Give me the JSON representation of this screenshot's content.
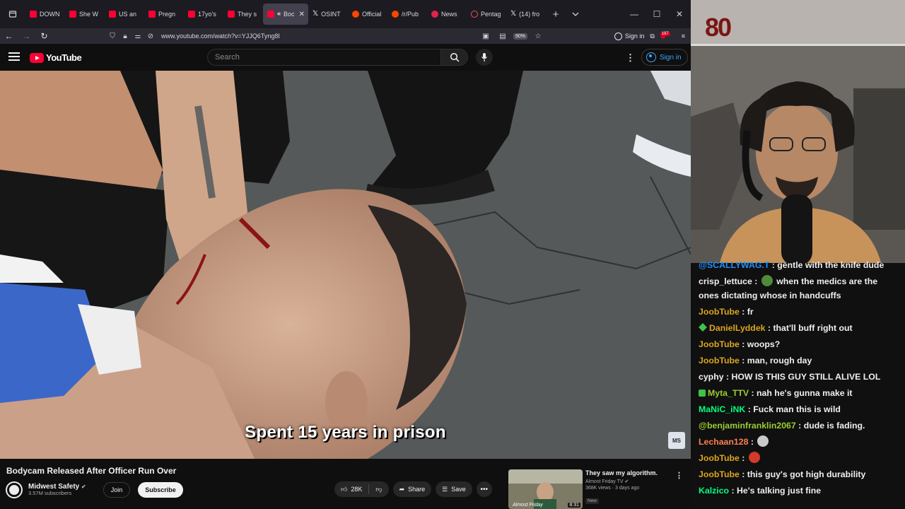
{
  "browser": {
    "tabs": [
      {
        "label": "DOWN",
        "icon": "youtube-favicon"
      },
      {
        "label": "She W",
        "icon": "youtube-favicon"
      },
      {
        "label": "US an",
        "icon": "youtube-favicon"
      },
      {
        "label": "Pregn",
        "icon": "youtube-favicon"
      },
      {
        "label": "17yo's",
        "icon": "youtube-favicon"
      },
      {
        "label": "They s",
        "icon": "youtube-favicon"
      },
      {
        "label": "Boc",
        "icon": "youtube-favicon",
        "active": true
      },
      {
        "label": "OSINT",
        "icon": "x-favicon"
      },
      {
        "label": "Official",
        "icon": "reddit-favicon"
      },
      {
        "label": "/r/Pub",
        "icon": "reddit-favicon"
      },
      {
        "label": "News",
        "icon": "news-favicon"
      },
      {
        "label": "Pentag",
        "icon": "pentagon-favicon"
      },
      {
        "label": "(14) fro",
        "icon": "x-favicon"
      }
    ],
    "url": "www.youtube.com/watch?v=YJJQ6Tyng8I",
    "zoom": "90%",
    "sign_in": "Sign in",
    "extension_badge": "197"
  },
  "youtube": {
    "logo_text": "YouTube",
    "search_placeholder": "Search",
    "sign_in": "Sign in"
  },
  "video": {
    "caption": "Spent 15 years in prison",
    "title": "Bodycam Released After Officer Run Over",
    "channel": "Midwest Safety",
    "subscribers": "3.57M subscribers",
    "join": "Join",
    "subscribe": "Subscribe",
    "likes": "28K",
    "share": "Share",
    "save": "Save"
  },
  "recommended": {
    "title": "They saw my algorithm.",
    "channel": "Almost Friday TV",
    "meta": "368K views · 3 days ago",
    "badge": "New",
    "duration": "8:31",
    "thumb_text": "Almost Friday"
  },
  "stream": {
    "overlay_text": "80",
    "chat": [
      {
        "user": "@SCALLYWAG.T",
        "text": "gentle with the knife dude",
        "color": "#1e90ff"
      },
      {
        "user": "crisp_lettuce",
        "text": "when the medics are the ones dictating whose in handcuffs",
        "color": "#f1f1f1",
        "emote": "pepe-emote"
      },
      {
        "user": "JoobTube",
        "text": "fr",
        "color": "#daa520"
      },
      {
        "user": "DanielLyddek",
        "text": "that'll buff right out",
        "color": "#daa520",
        "badge": "green-diamond-badge"
      },
      {
        "user": "JoobTube",
        "text": "woops?",
        "color": "#daa520"
      },
      {
        "user": "JoobTube",
        "text": "man, rough day",
        "color": "#daa520"
      },
      {
        "user": "cyphy",
        "text": "HOW IS THIS GUY STILL ALIVE LOL",
        "color": "#f1f1f1"
      },
      {
        "user": "Myta_TTV",
        "text": "nah he's gunna make it",
        "color": "#9acd32",
        "badge": "checkmark-badge"
      },
      {
        "user": "MaNiC_iNK",
        "text": "Fuck man this is wild",
        "color": "#00ff7f"
      },
      {
        "user": "@benjaminfranklin2067",
        "text": "dude is fading.",
        "color": "#9acd32"
      },
      {
        "user": "Lechaan128",
        "text": "",
        "color": "#ff7f50",
        "emote": "skull-emote"
      },
      {
        "user": "JoobTube",
        "text": "",
        "color": "#daa520",
        "emote": "devil-emote"
      },
      {
        "user": "JoobTube",
        "text": "this guy's got high durability",
        "color": "#daa520"
      },
      {
        "user": "Kalzico",
        "text": "He's talking just fine",
        "color": "#00ff7f"
      }
    ]
  }
}
